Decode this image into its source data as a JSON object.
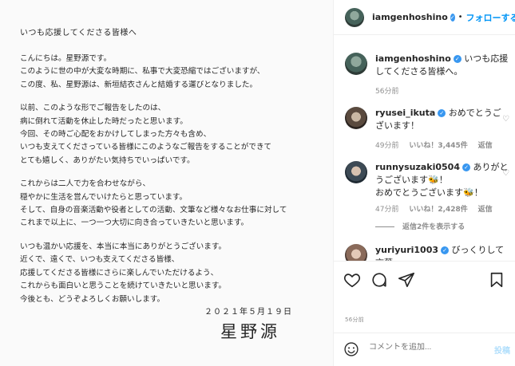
{
  "letter": {
    "heading": "いつも応援してくださる皆様へ",
    "paragraphs": [
      [
        "こんにちは。星野源です。",
        "このように世の中が大変な時期に、私事で大変恐縮ではございますが、",
        "この度、私、星野源は、新垣結衣さんと結婚する運びとなりました。"
      ],
      [
        "以前、このような形でご報告をしたのは、",
        "病に倒れて活動を休止した時だったと思います。",
        "今回、その時ご心配をおかけしてしまった方々も含め、",
        "いつも支えてくださっている皆様にこのようなご報告をすることができて",
        "とても嬉しく、ありがたい気持ちでいっぱいです。"
      ],
      [
        "これからは二人で力を合わせながら、",
        "穏やかに生活を営んでいけたらと思っています。",
        "そして、自身の音楽活動や役者としての活動、文筆など様々なお仕事に対して",
        "これまで以上に、一つ一つ大切に向き合っていきたいと思います。"
      ],
      [
        "いつも温かい応援を、本当に本当にありがとうございます。",
        "近くで、遠くで、いつも支えてくださる皆様、",
        "応援してくださる皆様にさらに楽しんでいただけるよう、",
        "これからも面白いと思うことを続けていきたいと思います。",
        "今後とも、どうぞよろしくお願いします。"
      ]
    ],
    "date": "２０２１年５月１９日",
    "signature": "星野源"
  },
  "header": {
    "username": "iamgenhoshino",
    "dot": "•",
    "follow_label": "フォローする"
  },
  "caption": {
    "username": "iamgenhoshino",
    "text": "いつも応援してくださる皆様へ。",
    "time": "56分前"
  },
  "comments": [
    {
      "username": "ryusei_ikuta",
      "text": "おめでとうございます！",
      "time": "49分前",
      "likes": "いいね！3,445件",
      "reply": "返信"
    },
    {
      "username": "runnysuzaki0504",
      "text": "ありがとうございます🐝！",
      "text2": "おめでとうございます🐝！",
      "time": "47分前",
      "likes": "いいね！2,428件",
      "reply": "返信"
    },
    {
      "username": "yuriyuri1003",
      "text": "びっくりして言葉"
    }
  ],
  "replies_label": "返信2件を表示する",
  "timestamp": "56分前",
  "compose": {
    "placeholder": "コメントを追加...",
    "post_label": "投稿"
  },
  "colors": {
    "accent": "#0095f6",
    "verified": "#3897f0",
    "muted": "#8e8e8e"
  }
}
